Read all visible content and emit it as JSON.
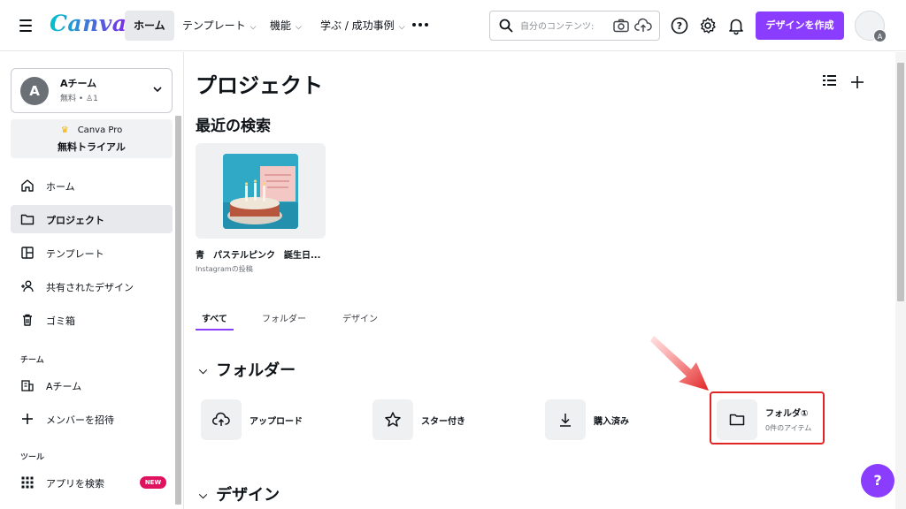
{
  "header": {
    "logo": "Canva",
    "nav": [
      {
        "label": "ホーム",
        "active": true,
        "dropdown": false
      },
      {
        "label": "テンプレート",
        "active": false,
        "dropdown": true
      },
      {
        "label": "機能",
        "active": false,
        "dropdown": true
      },
      {
        "label": "学ぶ / 成功事例",
        "active": false,
        "dropdown": true
      }
    ],
    "search_placeholder": "自分のコンテンツ:",
    "create_button": "デザインを作成",
    "avatar_initial": "A",
    "accent_color": "#8b3dff"
  },
  "sidebar": {
    "team": {
      "initial": "A",
      "name": "Aチーム",
      "sub": "無料 • ",
      "members": "1"
    },
    "pro": {
      "line1": "Canva Pro",
      "line2": "無料トライアル"
    },
    "items": [
      {
        "label": "ホーム",
        "icon": "home-icon",
        "active": false
      },
      {
        "label": "プロジェクト",
        "icon": "folder-icon",
        "active": true
      },
      {
        "label": "テンプレート",
        "icon": "template-icon",
        "active": false
      },
      {
        "label": "共有されたデザイン",
        "icon": "shared-users-icon",
        "active": false
      },
      {
        "label": "ゴミ箱",
        "icon": "trash-icon",
        "active": false
      }
    ],
    "team_section_label": "チーム",
    "team_items": [
      {
        "label": "Aチーム",
        "icon": "building-icon"
      },
      {
        "label": "メンバーを招待",
        "icon": "plus-icon"
      }
    ],
    "tools_section_label": "ツール",
    "tools_items": [
      {
        "label": "アプリを検索",
        "icon": "apps-grid-icon",
        "badge": "NEW"
      }
    ]
  },
  "main": {
    "title": "プロジェクト",
    "recent_heading": "最近の検索",
    "recent": [
      {
        "title": "青　パステルピンク　誕生日...",
        "subtitle": "Instagramの投稿"
      }
    ],
    "tabs": [
      {
        "label": "すべて",
        "active": true
      },
      {
        "label": "フォルダー",
        "active": false
      },
      {
        "label": "デザイン",
        "active": false
      }
    ],
    "folders_heading": "フォルダー",
    "folders": [
      {
        "label": "アップロード",
        "icon": "cloud-upload-icon"
      },
      {
        "label": "スター付き",
        "icon": "star-icon"
      },
      {
        "label": "購入済み",
        "icon": "download-icon"
      },
      {
        "label": "フォルダ①",
        "icon": "folder-icon",
        "subtitle": "0件のアイテム",
        "highlighted": true
      }
    ],
    "designs_heading": "デザイン"
  },
  "help_label": "?"
}
